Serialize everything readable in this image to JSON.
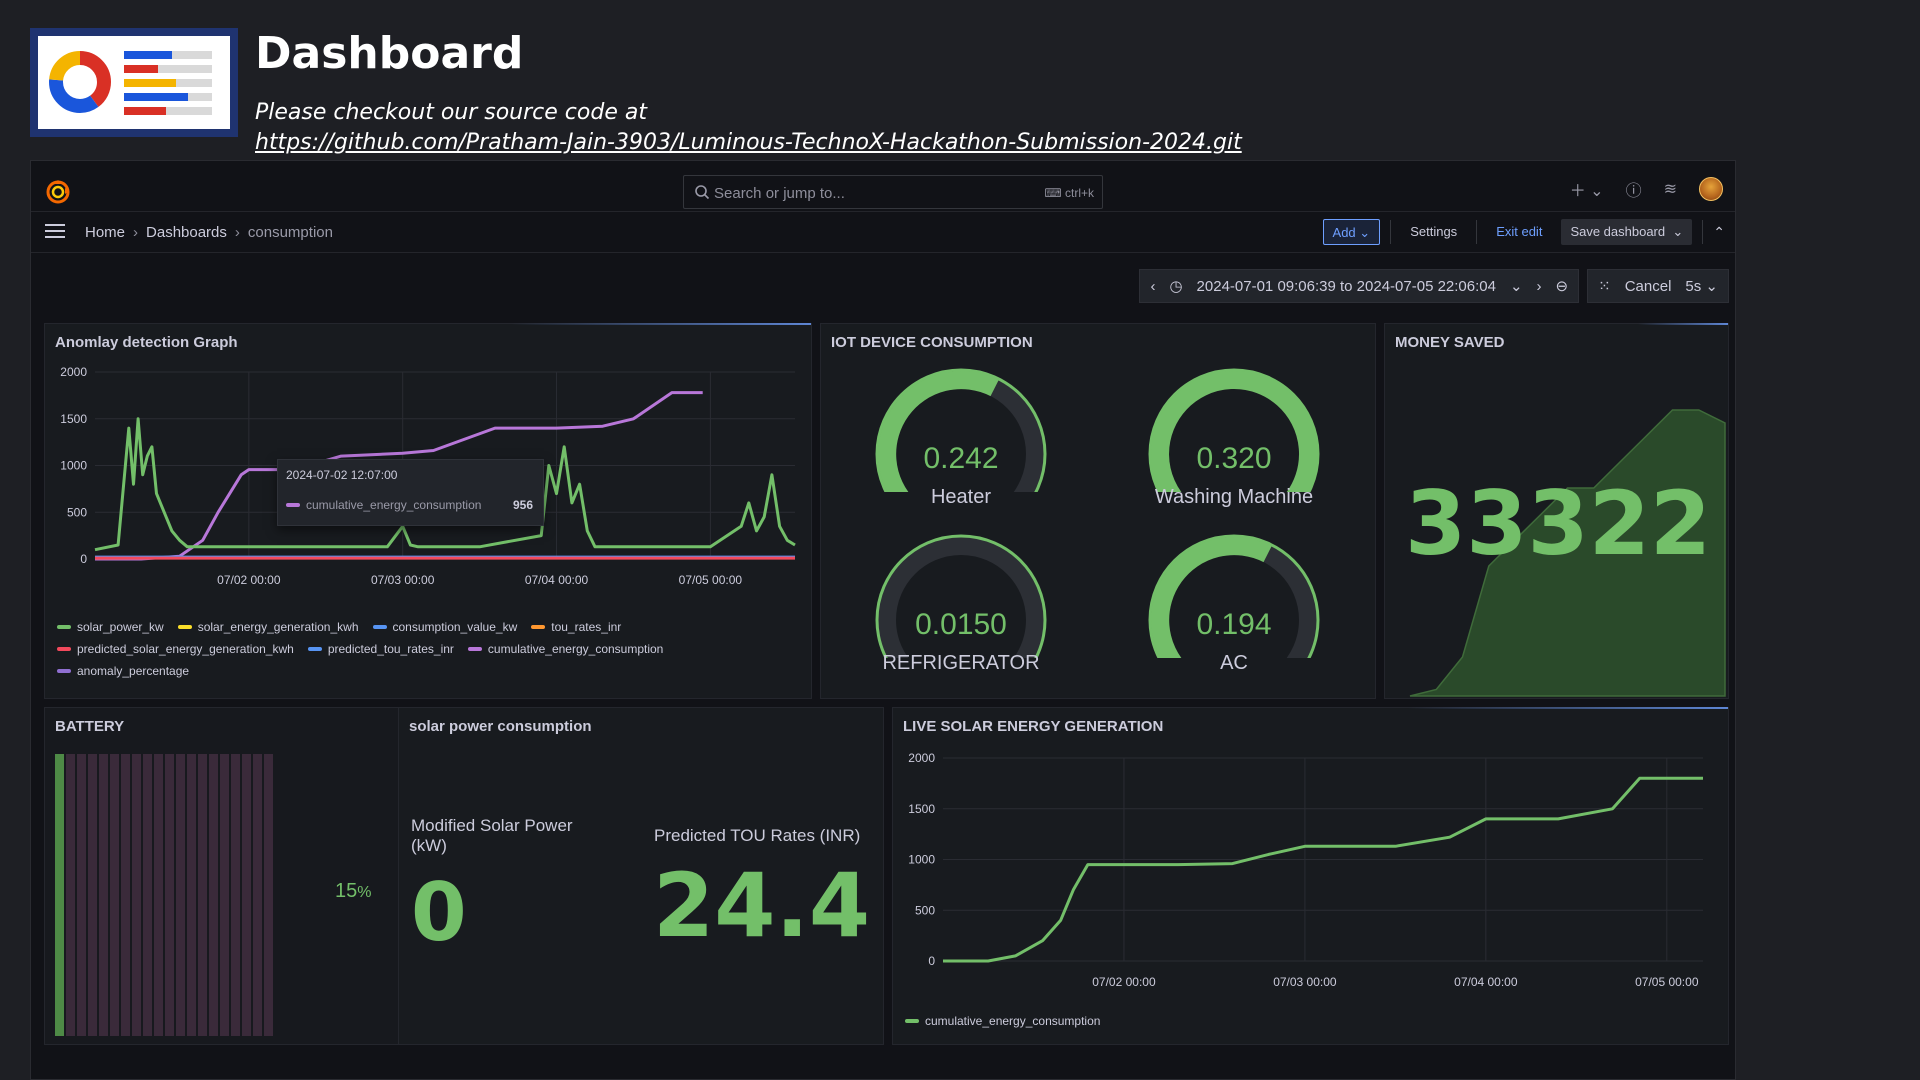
{
  "slide": {
    "title": "Dashboard",
    "subtitle": "Please checkout our source code at",
    "link": "https://github.com/Pratham-Jain-3903/Luminous-TechnoX-Hackathon-Submission-2024.git"
  },
  "topbar": {
    "search_placeholder": "Search or jump to...",
    "search_shortcut": "ctrl+k",
    "icons": [
      "plus-icon",
      "help-icon",
      "rss-icon",
      "avatar"
    ]
  },
  "breadcrumb": {
    "items": [
      "Home",
      "Dashboards",
      "consumption"
    ],
    "separator": "›"
  },
  "nav_actions": {
    "add_label": "Add",
    "settings_label": "Settings",
    "exit_label": "Exit edit",
    "save_label": "Save dashboard"
  },
  "timebar": {
    "range": "2024-07-01 09:06:39 to 2024-07-05 22:06:04",
    "cancel_label": "Cancel",
    "refresh_interval": "5s"
  },
  "panels": {
    "anomaly": {
      "title": "Anomlay detection Graph",
      "tooltip_time": "2024-07-02 12:07:00",
      "tooltip_series": "cumulative_energy_consumption",
      "tooltip_value": "956",
      "legend": [
        {
          "name": "solar_power_kw",
          "color": "#73bf69"
        },
        {
          "name": "solar_energy_generation_kwh",
          "color": "#fade2a"
        },
        {
          "name": "consumption_value_kw",
          "color": "#5794f2"
        },
        {
          "name": "tou_rates_inr",
          "color": "#ff9830"
        },
        {
          "name": "predicted_solar_energy_generation_kwh",
          "color": "#f2495c"
        },
        {
          "name": "predicted_tou_rates_inr",
          "color": "#5794f2"
        },
        {
          "name": "cumulative_energy_consumption",
          "color": "#b877d9"
        },
        {
          "name": "anomaly_percentage",
          "color": "#8f6fd1"
        }
      ]
    },
    "iot": {
      "title": "IOT DEVICE CONSUMPTION",
      "gauges": [
        {
          "value": "0.242",
          "label": "Heater",
          "fraction": 0.6
        },
        {
          "value": "0.320",
          "label": "Washing Machine",
          "fraction": 0.98
        },
        {
          "value": "0.0150",
          "label": "REFRIGERATOR",
          "fraction": 0.03
        },
        {
          "value": "0.194",
          "label": "AC",
          "fraction": 0.6
        }
      ]
    },
    "money": {
      "title": "MONEY SAVED",
      "value": "33322"
    },
    "battery": {
      "title": "BATTERY",
      "percent_value": "15",
      "percent_unit": "%",
      "fraction": 0.15
    },
    "solar_consumption": {
      "title": "solar power consumption",
      "left_label": "Modified Solar Power (kW)",
      "left_value": "0",
      "right_label": "Predicted TOU Rates (INR)",
      "right_value": "24.4"
    },
    "live_solar": {
      "title": "LIVE SOLAR ENERGY GENERATION",
      "legend": "cumulative_energy_consumption"
    }
  },
  "chart_data": [
    {
      "type": "line",
      "title": "Anomlay detection Graph",
      "x_ticks": [
        "07/02 00:00",
        "07/03 00:00",
        "07/04 00:00",
        "07/05 00:00"
      ],
      "y_ticks": [
        "0",
        "500",
        "1000",
        "1500",
        "2000"
      ],
      "ylim": [
        0,
        2000
      ],
      "xlim": [
        0,
        4.55
      ],
      "series": [
        {
          "name": "cumulative_energy_consumption",
          "color": "#b877d9",
          "x": [
            0,
            0.3,
            0.55,
            0.7,
            0.8,
            0.95,
            1.0,
            1.1,
            1.3,
            1.6,
            2.0,
            2.2,
            2.6,
            3.0,
            3.3,
            3.5,
            3.75,
            3.95
          ],
          "y": [
            0,
            0,
            30,
            200,
            500,
            900,
            956,
            956,
            956,
            1100,
            1130,
            1160,
            1400,
            1400,
            1420,
            1500,
            1780,
            1780
          ]
        },
        {
          "name": "solar_power_kw",
          "color": "#73bf69",
          "x": [
            0,
            0.15,
            0.22,
            0.25,
            0.28,
            0.31,
            0.34,
            0.37,
            0.4,
            0.45,
            0.5,
            0.55,
            0.6,
            1.0,
            1.5,
            1.9,
            2.0,
            2.05,
            2.1,
            2.5,
            2.9,
            2.95,
            3.0,
            3.05,
            3.1,
            3.15,
            3.2,
            3.25,
            3.4,
            4.0,
            4.2,
            4.25,
            4.3,
            4.35,
            4.4,
            4.45,
            4.5,
            4.55
          ],
          "y": [
            100,
            150,
            1400,
            800,
            1500,
            900,
            1100,
            1200,
            700,
            500,
            300,
            200,
            130,
            130,
            130,
            130,
            350,
            150,
            130,
            130,
            250,
            1000,
            700,
            1200,
            600,
            800,
            300,
            130,
            130,
            130,
            350,
            600,
            300,
            450,
            900,
            350,
            200,
            150
          ]
        },
        {
          "name": "consumption_value_kw",
          "color": "#5794f2",
          "x": [
            0,
            4.55
          ],
          "y": [
            20,
            20
          ]
        },
        {
          "name": "predicted_solar_energy_generation_kwh",
          "color": "#f2495c",
          "x": [
            0,
            4.55
          ],
          "y": [
            10,
            10
          ]
        }
      ]
    },
    {
      "type": "area",
      "title": "MONEY SAVED",
      "values": [
        0,
        50,
        300,
        1000,
        1200,
        1400,
        1600,
        1600,
        1800,
        2000,
        2200,
        2200,
        2100
      ],
      "ylim": [
        0,
        2400
      ]
    },
    {
      "type": "line",
      "title": "LIVE SOLAR ENERGY GENERATION",
      "x_ticks": [
        "07/02 00:00",
        "07/03 00:00",
        "07/04 00:00",
        "07/05 00:00"
      ],
      "y_ticks": [
        "0",
        "500",
        "1000",
        "1500",
        "2000"
      ],
      "ylim": [
        0,
        2000
      ],
      "xlim": [
        0,
        4.2
      ],
      "series": [
        {
          "name": "cumulative_energy_consumption",
          "color": "#73bf69",
          "x": [
            0,
            0.25,
            0.4,
            0.55,
            0.65,
            0.72,
            0.8,
            1.0,
            1.3,
            1.6,
            1.8,
            2.0,
            2.5,
            2.8,
            3.0,
            3.4,
            3.7,
            3.85,
            4.2
          ],
          "y": [
            0,
            0,
            50,
            200,
            400,
            700,
            950,
            950,
            950,
            960,
            1050,
            1130,
            1130,
            1220,
            1400,
            1400,
            1500,
            1800,
            1800
          ]
        }
      ]
    }
  ]
}
